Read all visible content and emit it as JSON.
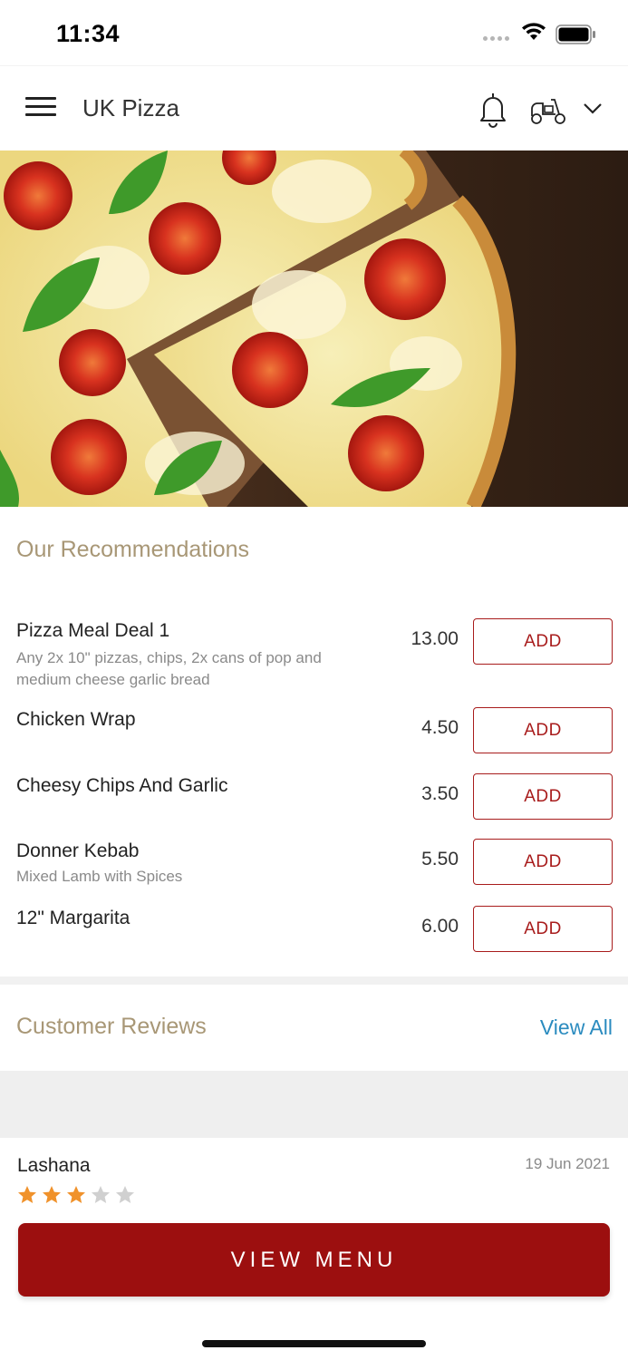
{
  "status_bar": {
    "time": "11:34"
  },
  "header": {
    "title": "UK Pizza",
    "icons": [
      "menu-icon",
      "bell-icon",
      "scooter-icon",
      "chevron-down-icon"
    ]
  },
  "hero": {
    "image": "pizza-photo"
  },
  "recommendations": {
    "title": "Our Recommendations",
    "items": [
      {
        "name": "Pizza Meal Deal 1",
        "description": "Any 2x 10\" pizzas, chips, 2x cans of pop and medium cheese garlic bread",
        "price": "13.00",
        "button": "ADD"
      },
      {
        "name": "Chicken Wrap",
        "description": "",
        "price": "4.50",
        "button": "ADD"
      },
      {
        "name": "Cheesy Chips And Garlic",
        "description": "",
        "price": "3.50",
        "button": "ADD"
      },
      {
        "name": "Donner Kebab",
        "description": "Mixed Lamb with Spices",
        "price": "5.50",
        "button": "ADD"
      },
      {
        "name": "12\" Margarita",
        "description": "",
        "price": "6.00",
        "button": "ADD"
      }
    ]
  },
  "reviews": {
    "title": "Customer Reviews",
    "view_all": "View All",
    "items": [
      {
        "name": "Lashana",
        "date": "19 Jun 2021",
        "rating": 3,
        "max_rating": 5
      }
    ]
  },
  "footer": {
    "view_menu": "VIEW MENU"
  },
  "colors": {
    "accent": "#9c0f0f",
    "section_title": "#a89776",
    "link": "#2a8bbf",
    "star_filled": "#f0922b",
    "star_empty": "#d0d0d0"
  }
}
